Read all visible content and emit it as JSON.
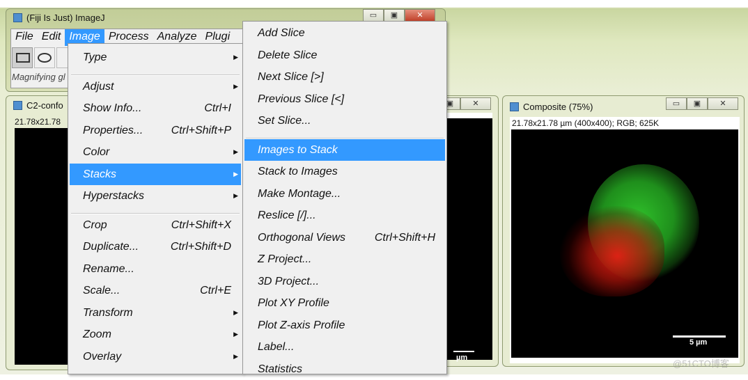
{
  "main_window": {
    "title": "(Fiji Is Just) ImageJ",
    "menubar": [
      "File",
      "Edit",
      "Image",
      "Process",
      "Analyze",
      "Plugi"
    ],
    "active_menu": "Image",
    "status": "Magnifying gl",
    "tools": [
      "rectangle-tool",
      "oval-tool",
      "polygon-tool"
    ]
  },
  "c2_window": {
    "title": "C2-confo",
    "info": "21.78x21.78"
  },
  "middle_window": {
    "scale_label": "µm"
  },
  "composite_window": {
    "title": "Composite (75%)",
    "info": "21.78x21.78 µm (400x400); RGB; 625K",
    "scale_label": "5 µm"
  },
  "image_menu": [
    {
      "label": "Type",
      "submenu": true
    },
    {
      "sep": true
    },
    {
      "label": "Adjust",
      "submenu": true
    },
    {
      "label": "Show Info...",
      "shortcut": "Ctrl+I"
    },
    {
      "label": "Properties...",
      "shortcut": "Ctrl+Shift+P"
    },
    {
      "label": "Color",
      "submenu": true
    },
    {
      "label": "Stacks",
      "submenu": true,
      "highlighted": true
    },
    {
      "label": "Hyperstacks",
      "submenu": true
    },
    {
      "sep": true
    },
    {
      "label": "Crop",
      "shortcut": "Ctrl+Shift+X"
    },
    {
      "label": "Duplicate...",
      "shortcut": "Ctrl+Shift+D"
    },
    {
      "label": "Rename..."
    },
    {
      "label": "Scale...",
      "shortcut": "Ctrl+E"
    },
    {
      "label": "Transform",
      "submenu": true
    },
    {
      "label": "Zoom",
      "submenu": true
    },
    {
      "label": "Overlay",
      "submenu": true
    }
  ],
  "stacks_menu": [
    {
      "label": "Add Slice"
    },
    {
      "label": "Delete Slice"
    },
    {
      "label": "Next Slice [>]"
    },
    {
      "label": "Previous Slice [<]"
    },
    {
      "label": "Set Slice..."
    },
    {
      "sep": true
    },
    {
      "label": "Images to Stack",
      "highlighted": true
    },
    {
      "label": "Stack to Images"
    },
    {
      "label": "Make Montage..."
    },
    {
      "label": "Reslice [/]..."
    },
    {
      "label": "Orthogonal Views",
      "shortcut": "Ctrl+Shift+H"
    },
    {
      "label": "Z Project..."
    },
    {
      "label": "3D Project..."
    },
    {
      "label": "Plot XY Profile"
    },
    {
      "label": "Plot Z-axis Profile"
    },
    {
      "label": "Label..."
    },
    {
      "label": "Statistics"
    }
  ],
  "watermark": "@51CTO博客",
  "colors": {
    "highlight": "#3399ff",
    "menu_bg": "#f0f0f0"
  }
}
